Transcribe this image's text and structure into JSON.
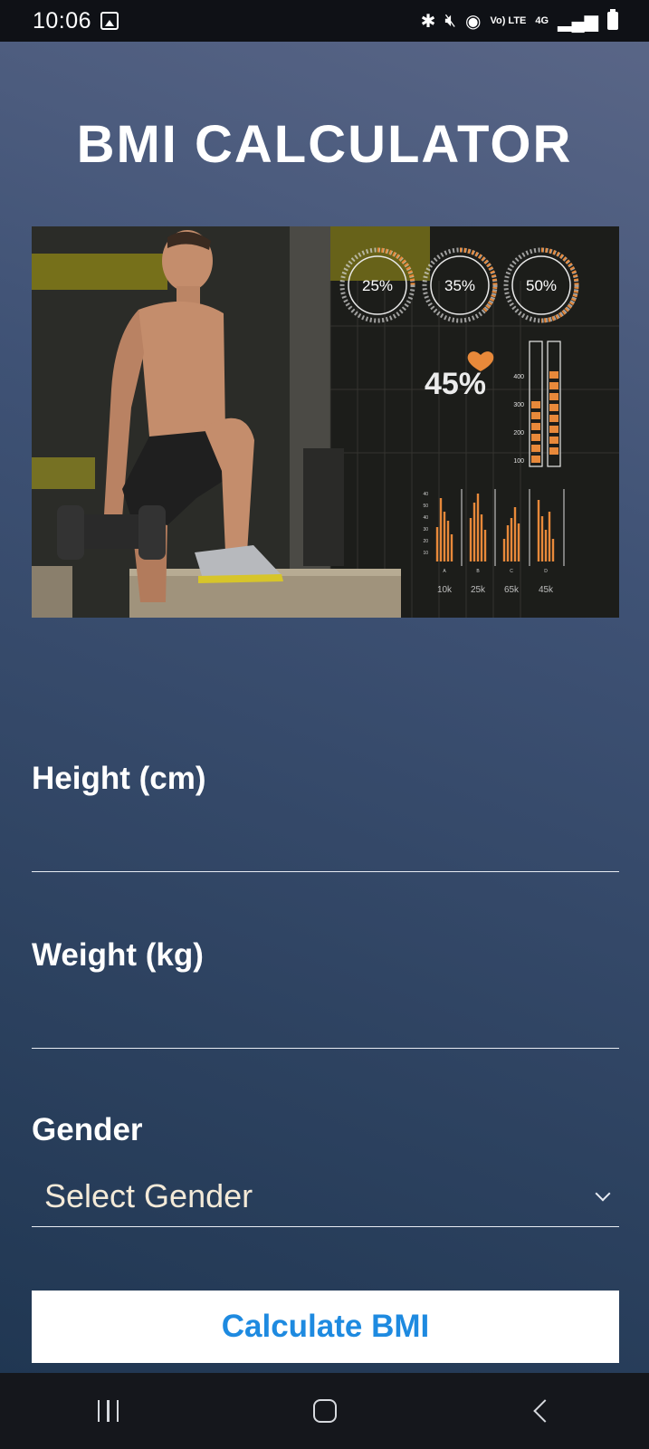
{
  "status_bar": {
    "time": "10:06",
    "icons": [
      "gallery-icon",
      "bluetooth-icon",
      "mute-icon",
      "hotspot-icon",
      "volte-icon",
      "4g-icon",
      "signal-icon",
      "battery-icon"
    ],
    "volte_label": "Vo) LTE",
    "network_label": "4G"
  },
  "app": {
    "title": "BMI CALCULATOR"
  },
  "hero_image": {
    "gauges": [
      "25%",
      "35%",
      "50%"
    ],
    "heart_value": "45%",
    "bar_scale": [
      "400",
      "300",
      "200",
      "100"
    ],
    "histogram_labels": [
      "10k",
      "25k",
      "65k",
      "45k"
    ],
    "histogram_groups": [
      "A",
      "B",
      "C",
      "D"
    ],
    "histogram_scale": [
      "40",
      "50",
      "40",
      "30",
      "20",
      "10"
    ]
  },
  "form": {
    "height_label": "Height (cm)",
    "height_value": "",
    "weight_label": "Weight (kg)",
    "weight_value": "",
    "gender_label": "Gender",
    "gender_selected": "Select Gender"
  },
  "actions": {
    "calculate_label": "Calculate BMI"
  },
  "colors": {
    "accent_text": "#1e8ae0",
    "hero_orange": "#e8893a"
  },
  "nav_bar": {
    "icons": [
      "recent-apps-icon",
      "home-icon",
      "back-icon"
    ]
  }
}
